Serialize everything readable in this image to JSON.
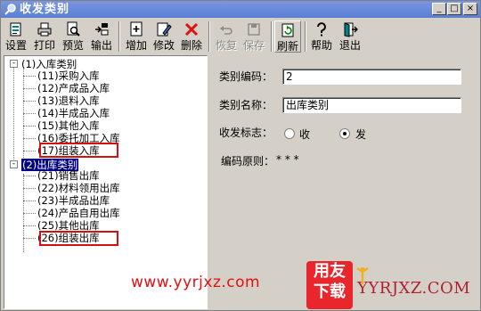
{
  "window": {
    "title": "收发类别",
    "buttons": [
      "_",
      "□",
      "×"
    ]
  },
  "toolbar": {
    "items": [
      {
        "label": "设置",
        "icon": "settings-icon",
        "enabled": true
      },
      {
        "label": "打印",
        "icon": "printer-icon",
        "enabled": true
      },
      {
        "label": "预览",
        "icon": "preview-icon",
        "enabled": true
      },
      {
        "label": "输出",
        "icon": "export-icon",
        "enabled": true
      },
      {
        "label": "增加",
        "icon": "add-icon",
        "enabled": true
      },
      {
        "label": "修改",
        "icon": "edit-icon",
        "enabled": true
      },
      {
        "label": "删除",
        "icon": "delete-icon",
        "enabled": true
      },
      {
        "label": "恢复",
        "icon": "undo-icon",
        "enabled": false
      },
      {
        "label": "保存",
        "icon": "save-icon",
        "enabled": false
      },
      {
        "label": "刷新",
        "icon": "refresh-icon",
        "enabled": true
      },
      {
        "label": "帮助",
        "icon": "help-icon",
        "enabled": true
      },
      {
        "label": "退出",
        "icon": "exit-icon",
        "enabled": true
      }
    ]
  },
  "tree": {
    "groups": [
      {
        "label": "(1)入库类别",
        "expander": "-",
        "children": [
          {
            "label": "(11)采购入库",
            "highlighted": false
          },
          {
            "label": "(12)产成品入库",
            "highlighted": false
          },
          {
            "label": "(13)退料入库",
            "highlighted": false
          },
          {
            "label": "(14)半成品入库",
            "highlighted": false
          },
          {
            "label": "(15)其他入库",
            "highlighted": false
          },
          {
            "label": "(16)委托加工入库",
            "highlighted": false
          },
          {
            "label": "(17)组装入库",
            "highlighted": true
          }
        ]
      },
      {
        "label": "(2)出库类别",
        "expander": "-",
        "selected": true,
        "children": [
          {
            "label": "(21)销售出库",
            "highlighted": false
          },
          {
            "label": "(22)材料领用出库",
            "highlighted": false
          },
          {
            "label": "(23)半成品出库",
            "highlighted": false
          },
          {
            "label": "(24)产品自用出库",
            "highlighted": false
          },
          {
            "label": "(25)其他出库",
            "highlighted": false
          },
          {
            "label": "(26)组装出库",
            "highlighted": true
          }
        ]
      }
    ],
    "highlight_color": "#d41010",
    "selected_color": "#000080"
  },
  "form": {
    "code_label": "类别编码：",
    "code_value": "2",
    "name_label": "类别名称：",
    "name_value": "出库类别",
    "flag_label": "收发标志：",
    "flag_options": [
      "收",
      "发"
    ],
    "flag_selected": "发",
    "rule_label": "编码原则：",
    "rule_value": "* * *"
  },
  "watermark": {
    "url": "www.yyrjxz.com",
    "logo_top": "用友",
    "logo_bottom": "下载",
    "brand": "YYRJXZ.COM"
  }
}
